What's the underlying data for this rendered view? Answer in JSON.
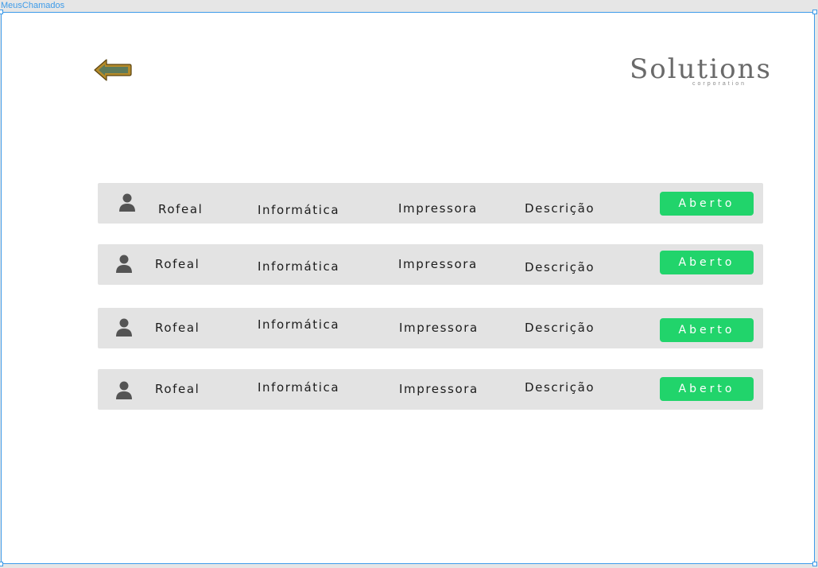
{
  "frame": {
    "label": "MeusChamados"
  },
  "logo": {
    "name": "Solutions",
    "tagline": "corporation"
  },
  "colors": {
    "accent_status": "#21d46b",
    "row_bg": "#e3e3e3",
    "selection": "#3d9be9",
    "back_arrow_fill": "#5d7a5a",
    "back_arrow_border": "#b58b2a"
  },
  "tickets": [
    {
      "user": "Rofeal",
      "department": "Informática",
      "category": "Impressora",
      "description": "Descrição",
      "status": "Aberto"
    },
    {
      "user": "Rofeal",
      "department": "Informática",
      "category": "Impressora",
      "description": "Descrição",
      "status": "Aberto"
    },
    {
      "user": "Rofeal",
      "department": "Informática",
      "category": "Impressora",
      "description": "Descrição",
      "status": "Aberto"
    },
    {
      "user": "Rofeal",
      "department": "Informática",
      "category": "Impressora",
      "description": "Descrição",
      "status": "Aberto"
    }
  ]
}
